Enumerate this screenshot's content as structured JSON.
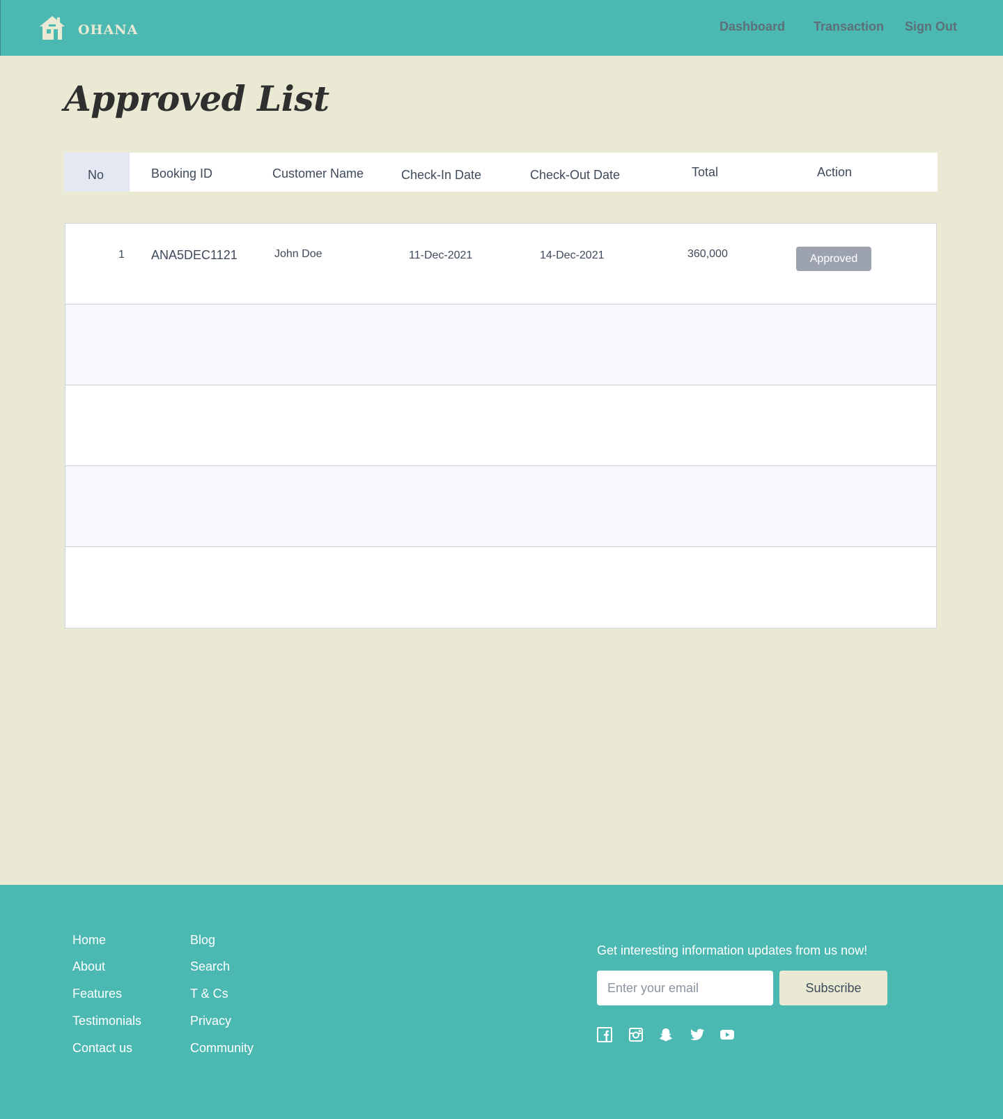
{
  "header": {
    "brand": "OHANA",
    "nav": {
      "dashboard": "Dashboard",
      "transaction": "Transaction",
      "sign_out": "Sign Out"
    }
  },
  "page": {
    "title": "Approved List"
  },
  "table": {
    "columns": {
      "no": "No",
      "booking_id": "Booking ID",
      "customer_name": "Customer Name",
      "check_in": "Check-In Date",
      "check_out": "Check-Out Date",
      "total": "Total",
      "action": "Action"
    },
    "rows": [
      {
        "no": "1",
        "booking_id": "ANA5DEC1121",
        "customer_name": "John Doe",
        "check_in": "11-Dec-2021",
        "check_out": "14-Dec-2021",
        "total": "360,000",
        "action": "Approved"
      }
    ]
  },
  "footer": {
    "links_col1": {
      "home": "Home",
      "about": "About",
      "features": "Features",
      "testimonials": "Testimonials",
      "contact": "Contact us"
    },
    "links_col2": {
      "blog": "Blog",
      "search": "Search",
      "terms": "T & Cs",
      "privacy": "Privacy",
      "community": "Community"
    },
    "newsletter": {
      "text": "Get interesting information updates from us now!",
      "placeholder": "Enter your email",
      "button": "Subscribe"
    },
    "social_icons": [
      "facebook-icon",
      "instagram-icon",
      "snapchat-icon",
      "twitter-icon",
      "youtube-icon"
    ]
  },
  "colors": {
    "teal": "#4BB8B2",
    "cream": "#EAEAD4",
    "badge_gray": "#9CA3AF"
  }
}
